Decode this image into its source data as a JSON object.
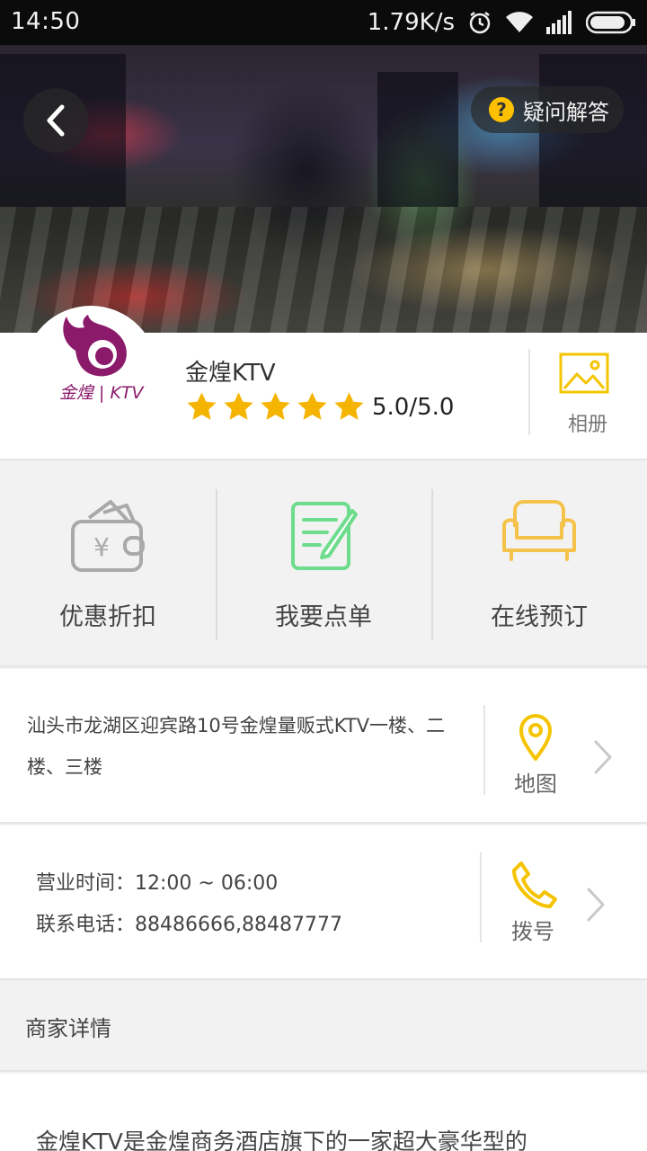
{
  "status_bar": {
    "time": "14:50",
    "network_speed": "1.79K/s"
  },
  "header": {
    "faq_label": "疑问解答"
  },
  "store": {
    "name": "金煌KTV",
    "rating_text": "5.0/5.0",
    "stars": 5,
    "album_label": "相册",
    "logo_text": "金煌 | KTV"
  },
  "actions": [
    {
      "label": "优惠折扣",
      "icon": "wallet-icon",
      "color": "#a9a9a9"
    },
    {
      "label": "我要点单",
      "icon": "order-icon",
      "color": "#6ddc8c"
    },
    {
      "label": "在线预订",
      "icon": "sofa-icon",
      "color": "#f5c24a"
    }
  ],
  "address": {
    "text": "汕头市龙湖区迎宾路10号金煌量贩式KTV一楼、二楼、三楼",
    "map_label": "地图"
  },
  "hours": {
    "business_hours": "营业时间：12:00 ~ 06:00",
    "phone": "联系电话：88486666,88487777",
    "dial_label": "拨号"
  },
  "details": {
    "title": "商家详情",
    "text": "金煌KTV是金煌商务酒店旗下的一家超大豪华型的"
  },
  "colors": {
    "accent": "#f5c400",
    "star": "#f5b400",
    "brand": "#8b1a6b"
  }
}
